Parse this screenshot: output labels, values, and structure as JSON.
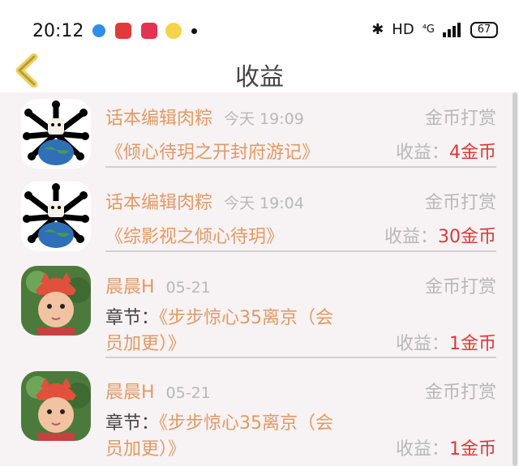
{
  "status_bar": {
    "time": "20:12",
    "right_text": "HD",
    "signal_text": "⁴G",
    "battery": "67"
  },
  "header": {
    "title": "收益"
  },
  "items": [
    {
      "name": "话本编辑肉粽",
      "time": "今天 19:09",
      "type": "金币打赏",
      "book": "《倾心待玥之开封府游记》",
      "chapter_prefix": "",
      "income_label": "收益：",
      "income_amount": "4金币",
      "avatar": "skull-crossbones-earth"
    },
    {
      "name": "话本编辑肉粽",
      "time": "今天 19:04",
      "type": "金币打赏",
      "book": "《综影视之倾心待玥》",
      "chapter_prefix": "",
      "income_label": "收益：",
      "income_amount": "30金币",
      "avatar": "skull-crossbones-earth"
    },
    {
      "name": "晨晨H",
      "time": "05-21",
      "type": "金币打赏",
      "chapter_prefix": "章节：",
      "book_line1": "《步步惊心35离京（会",
      "book_line2": "员加更）》",
      "income_label": "收益：",
      "income_amount": "1金币",
      "avatar": "child-photo"
    },
    {
      "name": "晨晨H",
      "time": "05-21",
      "type": "金币打赏",
      "chapter_prefix": "章节：",
      "book_line1": "《步步惊心35离京（会",
      "book_line2": "员加更）》",
      "income_label": "收益：",
      "income_amount": "1金币",
      "avatar": "child-photo"
    }
  ],
  "colors": {
    "accent": "#e09a66",
    "income_red": "#d83a3a",
    "muted": "#b8b8b8",
    "list_bg": "#f7f2f3"
  }
}
